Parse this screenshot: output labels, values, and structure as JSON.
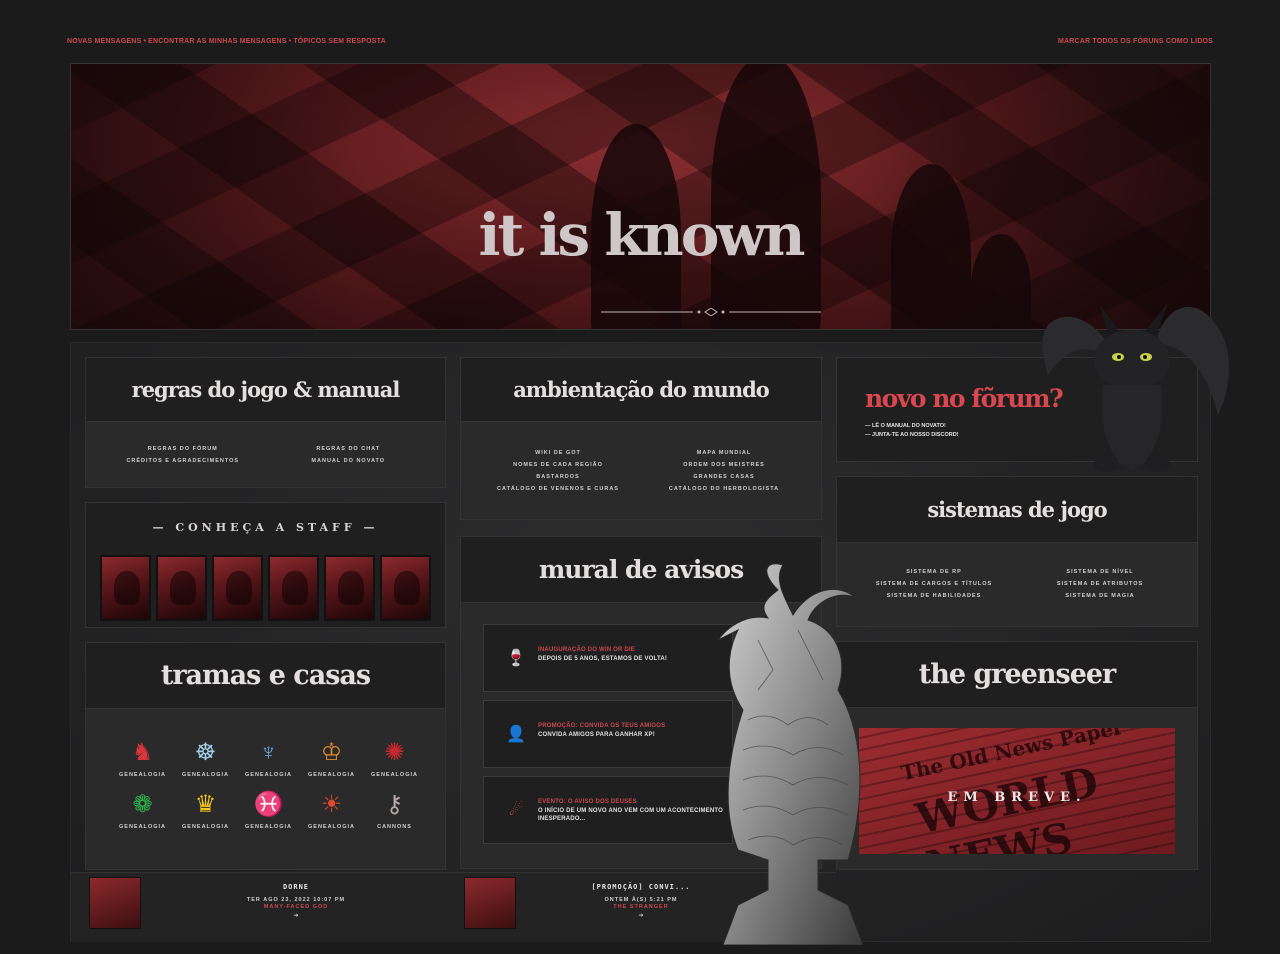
{
  "topbar": {
    "link_new": "Novas mensagens",
    "link_mine": "Encontrar as minhas mensagens",
    "link_unanswered": "Tópicos sem resposta",
    "link_mark_read": "Marcar todos os fóruns como lidos"
  },
  "banner": {
    "title": "it is known"
  },
  "rules_panel": {
    "title": "regras do jogo & manual",
    "links": [
      "Regras do fórum",
      "Regras do chat",
      "Créditos e agradecimentos",
      "Manual do novato"
    ]
  },
  "world_panel": {
    "title": "ambientação do mundo",
    "links": [
      "Wiki de GoT",
      "Mapa mundial",
      "Nomes de cada região",
      "Ordem dos meistres",
      "Bastardos",
      "Grandes casas",
      "Catálogo de venenos e curas",
      "Catálogo do herbologista"
    ]
  },
  "staff_panel": {
    "title": "— CONHEÇA A STAFF —"
  },
  "new_panel": {
    "title": "novo no fõrum?",
    "items": [
      "— LÊ O MANUAL DO NOVATO!",
      "— JUNTA-TE AO NOSSO DISCORD!"
    ]
  },
  "systems_panel": {
    "title": "sistemas de jogo",
    "links": [
      "Sistema de RP",
      "Sistema de nível",
      "Sistema de cargos e títulos",
      "Sistema de atributos",
      "Sistema de habilidades",
      "Sistema de magia"
    ]
  },
  "notices_panel": {
    "title": "mural de avisos",
    "items": [
      {
        "title": "Inauguração do Win or Die",
        "desc": "Depois de 5 anos, estamos de volta!",
        "icon": "toast-icon"
      },
      {
        "title": "Promoção: convida os teus amigos",
        "desc": "Convida amigos para ganhar XP!",
        "icon": "invite-user-icon"
      },
      {
        "title": "Evento: O aviso dos deuses",
        "desc": "O início de um novo ano vem com um acontecimento inesperado...",
        "icon": "comet-icon"
      }
    ]
  },
  "houses_panel": {
    "title": "tramas e casas",
    "houses": [
      {
        "label": "GENEALOGIA",
        "glyph": "♞",
        "color": "#d9363c"
      },
      {
        "label": "GENEALOGIA",
        "glyph": "☸",
        "color": "#9fd0e6"
      },
      {
        "label": "GENEALOGIA",
        "glyph": "♆",
        "color": "#6aa7d8"
      },
      {
        "label": "GENEALOGIA",
        "glyph": "♔",
        "color": "#e58a2d"
      },
      {
        "label": "GENEALOGIA",
        "glyph": "✺",
        "color": "#c9282d"
      },
      {
        "label": "GENEALOGIA",
        "glyph": "❁",
        "color": "#2bb54a"
      },
      {
        "label": "GENEALOGIA",
        "glyph": "♛",
        "color": "#f0c419"
      },
      {
        "label": "GENEALOGIA",
        "glyph": "♓",
        "color": "#5b9bd5"
      },
      {
        "label": "GENEALOGIA",
        "glyph": "☀",
        "color": "#e0482f"
      },
      {
        "label": "CANNONS",
        "glyph": "⚷",
        "color": "#b9aaaa"
      }
    ]
  },
  "greenseer_panel": {
    "title": "the greenseer",
    "soon": "EM BREVE."
  },
  "last_posts": [
    {
      "title": "DORNE",
      "date": "TER AGO 23, 2022 10:07 PM",
      "user": "MANY-FACED GOD"
    },
    {
      "title": "[PROMOÇÃO] CONVI...",
      "date": "ONTEM À(S) 5:21 PM",
      "user": "THE STRANGER"
    }
  ]
}
